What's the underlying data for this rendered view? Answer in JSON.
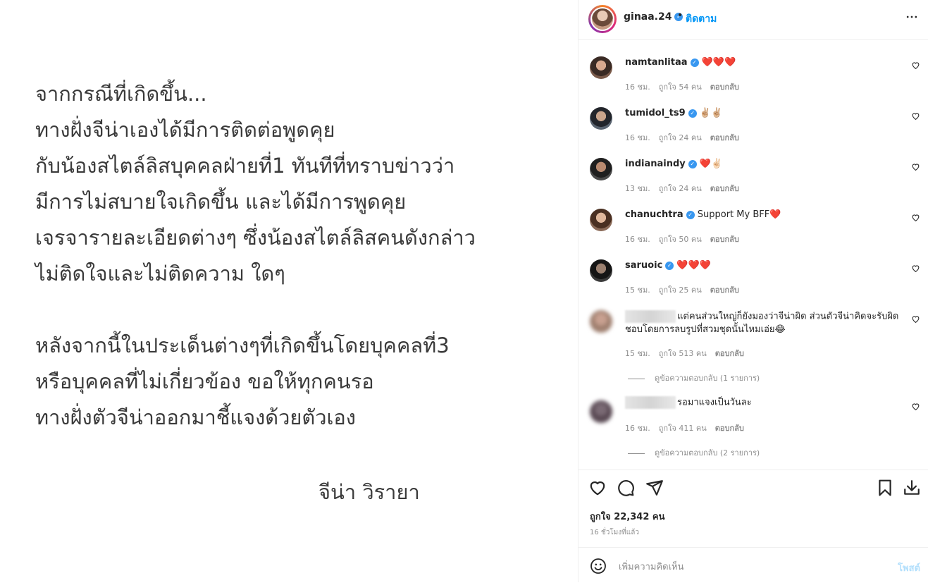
{
  "post": {
    "statement_lines": [
      "จากกรณีที่เกิดขึ้น...",
      "ทางฝั่งจีน่าเองได้มีการติดต่อพูดคุย",
      "กับน้องสไตล์ลิสบุคคลฝ่ายที่1 ทันทีที่ทราบข่าวว่า",
      "มีการไม่สบายใจเกิดขึ้น และได้มีการพูดคุย",
      "เจรจารายละเอียดต่างๆ ซึ่งน้องสไตล์ลิสคนดังกล่าว",
      "ไม่ติดใจและไม่ติดความ ใดๆ",
      "หลังจากนี้ในประเด็นต่างๆที่เกิดขึ้นโดยบุคคลที่3",
      "หรือบุคคลที่ไม่เกี่ยวข้อง ขอให้ทุกคนรอ",
      "ทางฝั่งตัวจีน่าออกมาชี้แจงด้วยตัวเอง"
    ],
    "signature": "จีน่า วิรายา"
  },
  "header": {
    "username": "ginaa.24",
    "separator": "•",
    "follow_label": "ติดตาม",
    "more_icon": "more-horizontal-icon"
  },
  "comments": [
    {
      "username": "namtanlitaa",
      "verified": true,
      "text": "❤️❤️❤️",
      "time": "16 ชม.",
      "likes": "ถูกใจ 54 คน",
      "reply": "ตอบกลับ"
    },
    {
      "username": "tumidol_ts9",
      "verified": true,
      "text": "✌🏼✌🏼",
      "time": "16 ชม.",
      "likes": "ถูกใจ 24 คน",
      "reply": "ตอบกลับ"
    },
    {
      "username": "indianaindy",
      "verified": true,
      "text": "❤️✌🏻",
      "time": "13 ชม.",
      "likes": "ถูกใจ 24 คน",
      "reply": "ตอบกลับ"
    },
    {
      "username": "chanuchtra",
      "verified": true,
      "text": "Support My BFF❤️",
      "time": "16 ชม.",
      "likes": "ถูกใจ 50 คน",
      "reply": "ตอบกลับ"
    },
    {
      "username": "saruoic",
      "verified": true,
      "text": "❤️❤️❤️",
      "time": "15 ชม.",
      "likes": "ถูกใจ 25 คน",
      "reply": "ตอบกลับ"
    },
    {
      "username": "",
      "verified": false,
      "text": "แต่คนส่วนใหญ่ก็ยังมองว่าจีน่าผิด ส่วนตัวจีน่าคิดจะรับผิดชอบโดยการลบรูปที่สวมชุดนั้นไหมเอ่ย😂",
      "time": "15 ชม.",
      "likes": "ถูกใจ 513 คน",
      "reply": "ตอบกลับ",
      "view_replies": "ดูข้อความตอบกลับ (1 รายการ)"
    },
    {
      "username": "",
      "verified": false,
      "text": "รอมาแจงเป็นวันละ",
      "time": "16 ชม.",
      "likes": "ถูกใจ 411 คน",
      "reply": "ตอบกลับ",
      "view_replies": "ดูข้อความตอบกลับ (2 รายการ)"
    }
  ],
  "actions": {
    "icons": [
      "heart-icon",
      "comment-icon",
      "share-icon",
      "bookmark-icon",
      "download-icon"
    ],
    "likes_label": "ถูกใจ 22,342 คน",
    "time_ago": "16 ชั่วโมงที่แล้ว"
  },
  "composer": {
    "placeholder": "เพิ่มความคิดเห็น",
    "post_label": "โพสต์",
    "emoji_icon": "smiley-icon"
  },
  "colors": {
    "accent": "#0095f6",
    "verified": "#3897f0",
    "post_disabled": "#b2dffc",
    "heart": "#ed4956"
  }
}
